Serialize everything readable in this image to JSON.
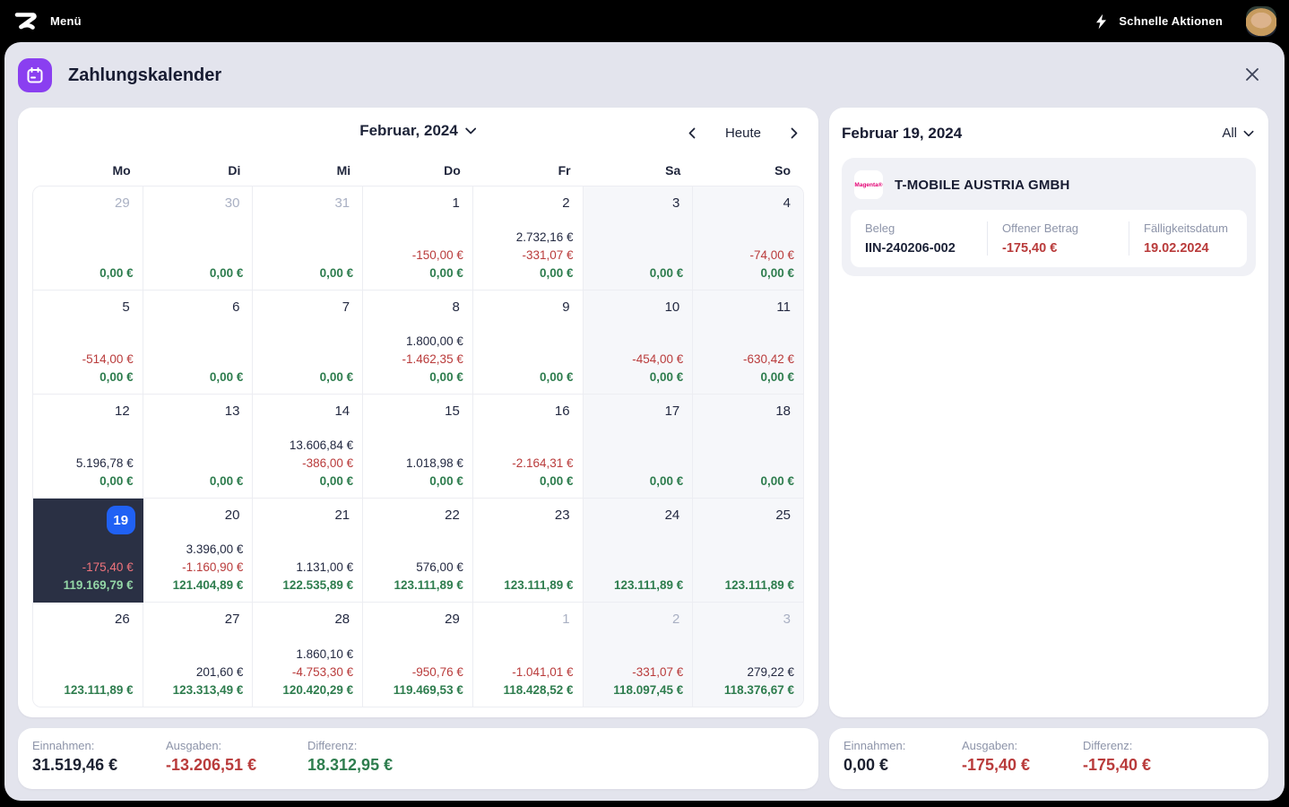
{
  "colors": {
    "accent_purple": "#8a3ff0",
    "badge_blue": "#2061f4",
    "selected_cell_bg": "#2a3044",
    "income_text": "#232941",
    "expense_red": "#b93b3b",
    "balance_green": "#2e7d4e",
    "magenta_brand": "#e20074",
    "shell_bg": "#e3e4ed"
  },
  "topbar": {
    "menu": "Menü",
    "quick_actions": "Schnelle Aktionen"
  },
  "header": {
    "title": "Zahlungskalender"
  },
  "calendar": {
    "month": "Februar, 2024",
    "today": "Heute",
    "weekdays": [
      "Mo",
      "Di",
      "Mi",
      "Do",
      "Fr",
      "Sa",
      "So"
    ],
    "weeks": [
      [
        {
          "day": "29",
          "muted": true,
          "amounts": [
            {
              "value": "0,00 €",
              "type": "balance"
            }
          ]
        },
        {
          "day": "30",
          "muted": true,
          "amounts": [
            {
              "value": "0,00 €",
              "type": "balance"
            }
          ]
        },
        {
          "day": "31",
          "muted": true,
          "amounts": [
            {
              "value": "0,00 €",
              "type": "balance"
            }
          ]
        },
        {
          "day": "1",
          "amounts": [
            {
              "value": "-150,00 €",
              "type": "expense"
            },
            {
              "value": "0,00 €",
              "type": "balance"
            }
          ]
        },
        {
          "day": "2",
          "amounts": [
            {
              "value": "2.732,16 €",
              "type": "income"
            },
            {
              "value": "-331,07 €",
              "type": "expense"
            },
            {
              "value": "0,00 €",
              "type": "balance"
            }
          ]
        },
        {
          "day": "3",
          "weekend": true,
          "amounts": [
            {
              "value": "0,00 €",
              "type": "balance"
            }
          ]
        },
        {
          "day": "4",
          "weekend": true,
          "amounts": [
            {
              "value": "-74,00 €",
              "type": "expense"
            },
            {
              "value": "0,00 €",
              "type": "balance"
            }
          ]
        }
      ],
      [
        {
          "day": "5",
          "amounts": [
            {
              "value": "-514,00 €",
              "type": "expense"
            },
            {
              "value": "0,00 €",
              "type": "balance"
            }
          ]
        },
        {
          "day": "6",
          "amounts": [
            {
              "value": "0,00 €",
              "type": "balance"
            }
          ]
        },
        {
          "day": "7",
          "amounts": [
            {
              "value": "0,00 €",
              "type": "balance"
            }
          ]
        },
        {
          "day": "8",
          "amounts": [
            {
              "value": "1.800,00 €",
              "type": "income"
            },
            {
              "value": "-1.462,35 €",
              "type": "expense"
            },
            {
              "value": "0,00 €",
              "type": "balance"
            }
          ]
        },
        {
          "day": "9",
          "amounts": [
            {
              "value": "0,00 €",
              "type": "balance"
            }
          ]
        },
        {
          "day": "10",
          "weekend": true,
          "amounts": [
            {
              "value": "-454,00 €",
              "type": "expense"
            },
            {
              "value": "0,00 €",
              "type": "balance"
            }
          ]
        },
        {
          "day": "11",
          "weekend": true,
          "amounts": [
            {
              "value": "-630,42 €",
              "type": "expense"
            },
            {
              "value": "0,00 €",
              "type": "balance"
            }
          ]
        }
      ],
      [
        {
          "day": "12",
          "amounts": [
            {
              "value": "5.196,78 €",
              "type": "income"
            },
            {
              "value": "0,00 €",
              "type": "balance"
            }
          ]
        },
        {
          "day": "13",
          "amounts": [
            {
              "value": "0,00 €",
              "type": "balance"
            }
          ]
        },
        {
          "day": "14",
          "amounts": [
            {
              "value": "13.606,84 €",
              "type": "income"
            },
            {
              "value": "-386,00 €",
              "type": "expense"
            },
            {
              "value": "0,00 €",
              "type": "balance"
            }
          ]
        },
        {
          "day": "15",
          "amounts": [
            {
              "value": "1.018,98 €",
              "type": "income"
            },
            {
              "value": "0,00 €",
              "type": "balance"
            }
          ]
        },
        {
          "day": "16",
          "amounts": [
            {
              "value": "-2.164,31 €",
              "type": "expense"
            },
            {
              "value": "0,00 €",
              "type": "balance"
            }
          ]
        },
        {
          "day": "17",
          "weekend": true,
          "amounts": [
            {
              "value": "0,00 €",
              "type": "balance"
            }
          ]
        },
        {
          "day": "18",
          "weekend": true,
          "amounts": [
            {
              "value": "0,00 €",
              "type": "balance"
            }
          ]
        }
      ],
      [
        {
          "day": "19",
          "selected": true,
          "amounts": [
            {
              "value": "-175,40 €",
              "type": "expense"
            },
            {
              "value": "119.169,79 €",
              "type": "balance"
            }
          ]
        },
        {
          "day": "20",
          "amounts": [
            {
              "value": "3.396,00 €",
              "type": "income"
            },
            {
              "value": "-1.160,90 €",
              "type": "expense"
            },
            {
              "value": "121.404,89 €",
              "type": "balance"
            }
          ]
        },
        {
          "day": "21",
          "amounts": [
            {
              "value": "1.131,00 €",
              "type": "income"
            },
            {
              "value": "122.535,89 €",
              "type": "balance"
            }
          ]
        },
        {
          "day": "22",
          "amounts": [
            {
              "value": "576,00 €",
              "type": "income"
            },
            {
              "value": "123.111,89 €",
              "type": "balance"
            }
          ]
        },
        {
          "day": "23",
          "amounts": [
            {
              "value": "123.111,89 €",
              "type": "balance"
            }
          ]
        },
        {
          "day": "24",
          "weekend": true,
          "amounts": [
            {
              "value": "123.111,89 €",
              "type": "balance"
            }
          ]
        },
        {
          "day": "25",
          "weekend": true,
          "amounts": [
            {
              "value": "123.111,89 €",
              "type": "balance"
            }
          ]
        }
      ],
      [
        {
          "day": "26",
          "amounts": [
            {
              "value": "123.111,89 €",
              "type": "balance"
            }
          ]
        },
        {
          "day": "27",
          "amounts": [
            {
              "value": "201,60 €",
              "type": "income"
            },
            {
              "value": "123.313,49 €",
              "type": "balance"
            }
          ]
        },
        {
          "day": "28",
          "amounts": [
            {
              "value": "1.860,10 €",
              "type": "income"
            },
            {
              "value": "-4.753,30 €",
              "type": "expense"
            },
            {
              "value": "120.420,29 €",
              "type": "balance"
            }
          ]
        },
        {
          "day": "29",
          "amounts": [
            {
              "value": "-950,76 €",
              "type": "expense"
            },
            {
              "value": "119.469,53 €",
              "type": "balance"
            }
          ]
        },
        {
          "day": "1",
          "muted": true,
          "amounts": [
            {
              "value": "-1.041,01 €",
              "type": "expense"
            },
            {
              "value": "118.428,52 €",
              "type": "balance"
            }
          ]
        },
        {
          "day": "2",
          "muted": true,
          "weekend": true,
          "amounts": [
            {
              "value": "-331,07 €",
              "type": "expense"
            },
            {
              "value": "118.097,45 €",
              "type": "balance"
            }
          ]
        },
        {
          "day": "3",
          "muted": true,
          "weekend": true,
          "amounts": [
            {
              "value": "279,22 €",
              "type": "income"
            },
            {
              "value": "118.376,67 €",
              "type": "balance"
            }
          ]
        }
      ]
    ]
  },
  "details": {
    "date_title": "Februar 19, 2024",
    "filter": "All",
    "vendor": {
      "logo_text": "Magenta®",
      "name": "T-MOBILE AUSTRIA GMBH",
      "fields": [
        {
          "label": "Beleg",
          "value": "IIN-240206-002",
          "tone": "dark"
        },
        {
          "label": "Offener Betrag",
          "value": "-175,40 €",
          "tone": "negative"
        },
        {
          "label": "Fälligkeitsdatum",
          "value": "19.02.2024",
          "tone": "negative"
        }
      ]
    }
  },
  "summary_left": {
    "items": [
      {
        "label": "Einnahmen:",
        "value": "31.519,46 €",
        "tone": "dark"
      },
      {
        "label": "Ausgaben:",
        "value": "-13.206,51 €",
        "tone": "negative"
      },
      {
        "label": "Differenz:",
        "value": "18.312,95 €",
        "tone": "positive"
      }
    ]
  },
  "summary_right": {
    "items": [
      {
        "label": "Einnahmen:",
        "value": "0,00 €",
        "tone": "dark"
      },
      {
        "label": "Ausgaben:",
        "value": "-175,40 €",
        "tone": "negative"
      },
      {
        "label": "Differenz:",
        "value": "-175,40 €",
        "tone": "negative"
      }
    ]
  }
}
